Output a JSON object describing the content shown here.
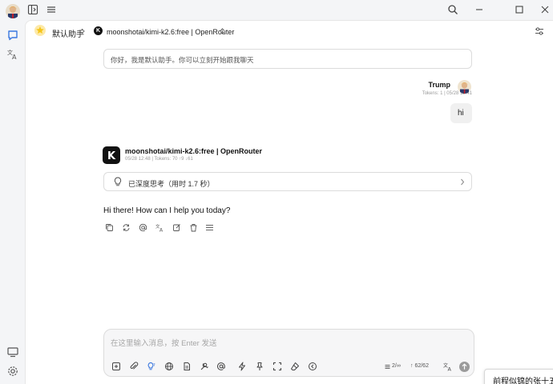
{
  "assistant": {
    "name": "默认助手",
    "greeting": "你好，我是默认助手。你可以立刻开始跟我聊天"
  },
  "model_selector": {
    "label": "moonshotai/kimi-k2.6:free | OpenRouter",
    "logo_letter": "K"
  },
  "user_message": {
    "name": "Trump",
    "meta": "Tokens: 1 | 05/28 12:41",
    "text": "hi"
  },
  "bot_message": {
    "name": "moonshotai/kimi-k2.6:free | OpenRouter",
    "meta": "05/28 12:48 | Tokens: 70 ↑9 ↓61",
    "thinking": "已深度思考（用时 1.7 秒）",
    "text": "Hi there! How can I help you today?"
  },
  "input": {
    "placeholder": "在这里输入消息，按 Enter 发送",
    "context_count": "2/∞",
    "token_count": "↑ 62/62"
  },
  "toast": {
    "text": "前程似锦的张十五"
  },
  "colors": {
    "accent": "#222222",
    "send_disabled": "#9b9b9b",
    "star": "#f5c518"
  }
}
